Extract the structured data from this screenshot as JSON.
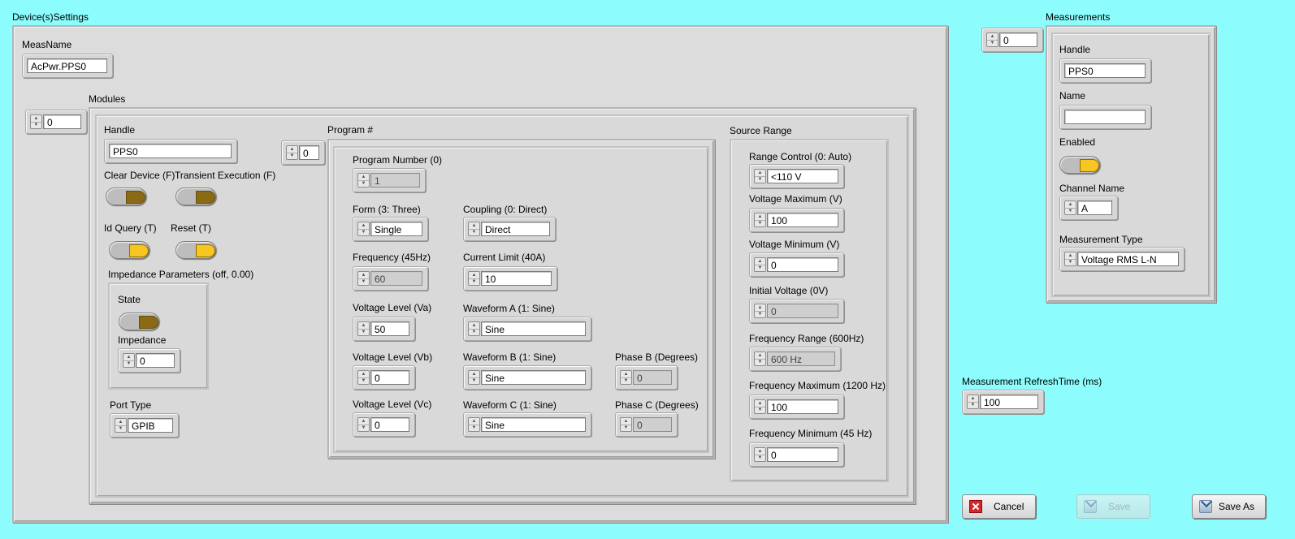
{
  "device_settings": {
    "title": "Device(s)Settings",
    "meas_name_label": "MeasName",
    "meas_name_value": "AcPwr.PPS0",
    "modules_index": "0",
    "modules_label": "Modules",
    "handle_label": "Handle",
    "handle_value": "PPS0",
    "clear_device_label": "Clear Device (F)",
    "transient_execution_label": "Transient Execution (F)",
    "id_query_label": "Id Query (T)",
    "reset_label": "Reset (T)",
    "impedance_params_label": "Impedance Parameters (off, 0.00)",
    "state_label": "State",
    "impedance_label": "Impedance",
    "impedance_value": "0",
    "port_type_label": "Port Type",
    "port_type_value": "GPIB",
    "program_label": "Program #",
    "program_index": "0",
    "program": {
      "program_number_label": "Program Number (0)",
      "program_number_value": "1",
      "form_label": "Form (3: Three)",
      "form_value": "Single",
      "coupling_label": "Coupling  (0: Direct)",
      "coupling_value": "Direct",
      "frequency_label": "Frequency (45Hz)",
      "frequency_value": "60",
      "current_limit_label": "Current Limit (40A)",
      "current_limit_value": "10",
      "voltage_va_label": "Voltage Level (Va)",
      "voltage_va_value": "50",
      "waveform_a_label": "Waveform A (1: Sine)",
      "waveform_a_value": "Sine",
      "voltage_vb_label": "Voltage Level (Vb)",
      "voltage_vb_value": "0",
      "waveform_b_label": "Waveform B (1: Sine)",
      "waveform_b_value": "Sine",
      "phase_b_label": "Phase B (Degrees)",
      "phase_b_value": "0",
      "voltage_vc_label": "Voltage Level (Vc)",
      "voltage_vc_value": "0",
      "waveform_c_label": "Waveform C (1: Sine)",
      "waveform_c_value": "Sine",
      "phase_c_label": "Phase C (Degrees)",
      "phase_c_value": "0"
    },
    "source_range": {
      "title": "Source Range",
      "range_control_label": "Range Control (0: Auto)",
      "range_control_value": "<110 V",
      "voltage_max_label": "Voltage Maximum (V)",
      "voltage_max_value": "100",
      "voltage_min_label": "Voltage Minimum (V)",
      "voltage_min_value": "0",
      "initial_voltage_label": "Initial Voltage (0V)",
      "initial_voltage_value": "0",
      "frequency_range_label": "Frequency Range (600Hz)",
      "frequency_range_value": "600 Hz",
      "frequency_max_label": "Frequency Maximum (1200 Hz)",
      "frequency_max_value": "100",
      "frequency_min_label": "Frequency Minimum (45 Hz)",
      "frequency_min_value": "0"
    }
  },
  "measurements": {
    "title": "Measurements",
    "index": "0",
    "handle_label": "Handle",
    "handle_value": "PPS0",
    "name_label": "Name",
    "name_value": "",
    "enabled_label": "Enabled",
    "channel_name_label": "Channel Name",
    "channel_name_value": "A",
    "measurement_type_label": "Measurement Type",
    "measurement_type_value": "Voltage RMS L-N",
    "refresh_label": "Measurement RefreshTime (ms)",
    "refresh_value": "100"
  },
  "buttons": {
    "cancel": "Cancel",
    "save": "Save",
    "save_as": "Save As"
  },
  "icons": {
    "cancel": "close-icon",
    "save": "save-icon",
    "save_as": "save-as-icon",
    "increment": "spinner-up-down-icon"
  },
  "colors": {
    "background": "#8cfcfc",
    "panel": "#dcdcdc",
    "led_on": "#f8c623",
    "led_off": "#8a6a14",
    "cancel_icon": "#d8242a"
  }
}
